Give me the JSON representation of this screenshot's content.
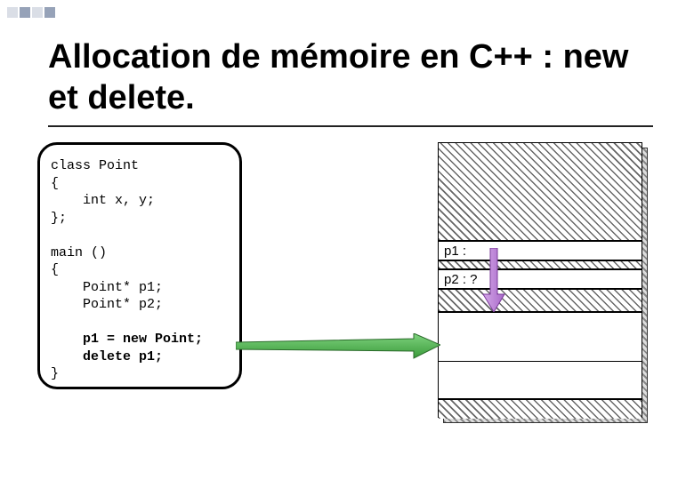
{
  "title": "Allocation de mémoire en C++ : new et delete.",
  "code": {
    "line1": "class Point",
    "line2": "{",
    "line3": "    int x, y;",
    "line4": "};",
    "line5": "",
    "line6": "main ()",
    "line7": "{",
    "line8": "    Point* p1;",
    "line9": "    Point* p2;",
    "line10": "",
    "line11": "    p1 = new Point;",
    "line12": "    delete p1;",
    "line13": "}"
  },
  "memory": {
    "p1_label": "p1 :",
    "p2_label": "p2 : ?"
  }
}
